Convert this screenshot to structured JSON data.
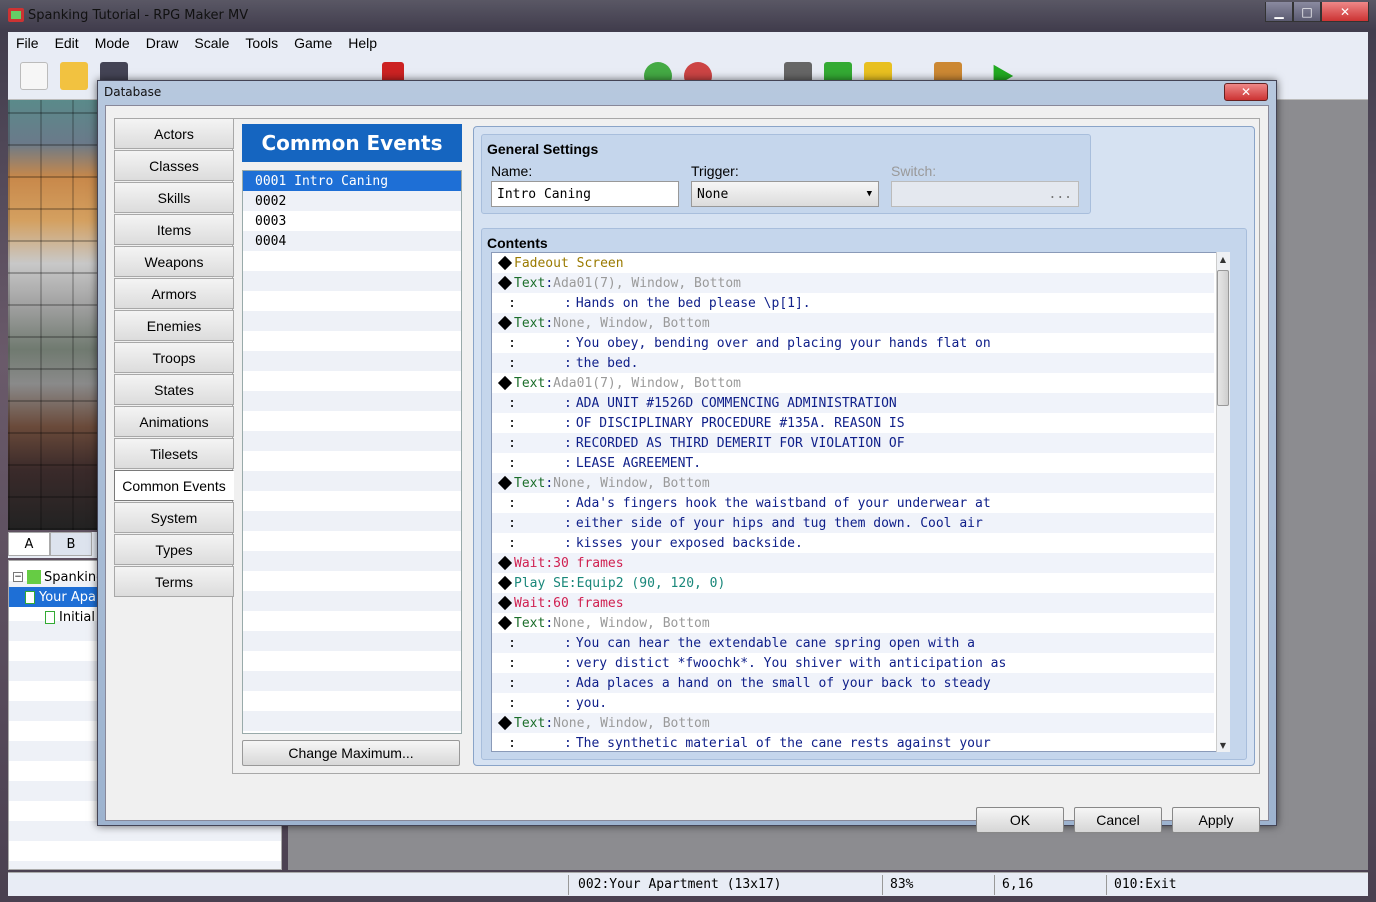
{
  "window": {
    "title": "Spanking Tutorial - RPG Maker MV"
  },
  "menu": [
    "File",
    "Edit",
    "Mode",
    "Draw",
    "Scale",
    "Tools",
    "Game",
    "Help"
  ],
  "layer_tabs": [
    "A",
    "B"
  ],
  "map_tree": [
    "Spanking Tutorial",
    "Your Apartment",
    "Initial"
  ],
  "status": {
    "map": "002:Your Apartment (13x17)",
    "zoom": "83%",
    "coords": "6,16",
    "event": "010:Exit"
  },
  "database": {
    "title": "Database",
    "categories": [
      "Actors",
      "Classes",
      "Skills",
      "Items",
      "Weapons",
      "Armors",
      "Enemies",
      "Troops",
      "States",
      "Animations",
      "Tilesets",
      "Common Events",
      "System",
      "Types",
      "Terms"
    ],
    "active_category": "Common Events",
    "list_header": "Common Events",
    "list_items": [
      "0001 Intro Caning",
      "0002",
      "0003",
      "0004"
    ],
    "change_max_label": "Change Maximum...",
    "general": {
      "heading": "General Settings",
      "name_label": "Name:",
      "name_value": "Intro Caning",
      "trigger_label": "Trigger:",
      "trigger_value": "None",
      "switch_label": "Switch:",
      "switch_value": "..."
    },
    "contents_heading": "Contents",
    "contents": [
      {
        "kind": "cmd",
        "cmd": "Fadeout Screen",
        "cls": "c-fade",
        "arg": "",
        "argcls": ""
      },
      {
        "kind": "cmd",
        "cmd": "Text",
        "cls": "c-text",
        "arg": "Ada01(7), Window, Bottom",
        "argcls": "c-gray"
      },
      {
        "kind": "cont",
        "arg": "Hands on the bed please \\p[1]."
      },
      {
        "kind": "cmd",
        "cmd": "Text",
        "cls": "c-text",
        "arg": "None, Window, Bottom",
        "argcls": "c-gray"
      },
      {
        "kind": "cont",
        "arg": "You obey, bending over and placing your hands flat on"
      },
      {
        "kind": "cont",
        "arg": "the bed."
      },
      {
        "kind": "cmd",
        "cmd": "Text",
        "cls": "c-text",
        "arg": "Ada01(7), Window, Bottom",
        "argcls": "c-gray"
      },
      {
        "kind": "cont",
        "arg": "ADA UNIT #1526D COMMENCING ADMINISTRATION"
      },
      {
        "kind": "cont",
        "arg": "OF DISCIPLINARY PROCEDURE #135A. REASON IS"
      },
      {
        "kind": "cont",
        "arg": "RECORDED AS THIRD DEMERIT FOR VIOLATION OF"
      },
      {
        "kind": "cont",
        "arg": "LEASE AGREEMENT."
      },
      {
        "kind": "cmd",
        "cmd": "Text",
        "cls": "c-text",
        "arg": "None, Window, Bottom",
        "argcls": "c-gray"
      },
      {
        "kind": "cont",
        "arg": "Ada's fingers hook the waistband of your underwear at"
      },
      {
        "kind": "cont",
        "arg": "either side of your hips and tug them down. Cool air"
      },
      {
        "kind": "cont",
        "arg": "kisses your exposed backside."
      },
      {
        "kind": "cmd",
        "cmd": "Wait",
        "cls": "c-wait",
        "arg": "30 frames",
        "argcls": "c-wait"
      },
      {
        "kind": "cmd",
        "cmd": "Play SE",
        "cls": "c-se",
        "arg": "Equip2 (90, 120, 0)",
        "argcls": "c-se"
      },
      {
        "kind": "cmd",
        "cmd": "Wait",
        "cls": "c-wait",
        "arg": "60 frames",
        "argcls": "c-wait"
      },
      {
        "kind": "cmd",
        "cmd": "Text",
        "cls": "c-text",
        "arg": "None, Window, Bottom",
        "argcls": "c-gray"
      },
      {
        "kind": "cont",
        "arg": "You can hear the extendable cane spring open with a"
      },
      {
        "kind": "cont",
        "arg": "very distict *fwoochk*. You shiver with anticipation as"
      },
      {
        "kind": "cont",
        "arg": "Ada places a hand on the small of your back to steady"
      },
      {
        "kind": "cont",
        "arg": "you."
      },
      {
        "kind": "cmd",
        "cmd": "Text",
        "cls": "c-text",
        "arg": "None, Window, Bottom",
        "argcls": "c-gray"
      },
      {
        "kind": "cont",
        "arg": "The synthetic material of the cane rests against your"
      }
    ],
    "buttons": {
      "ok": "OK",
      "cancel": "Cancel",
      "apply": "Apply"
    }
  }
}
